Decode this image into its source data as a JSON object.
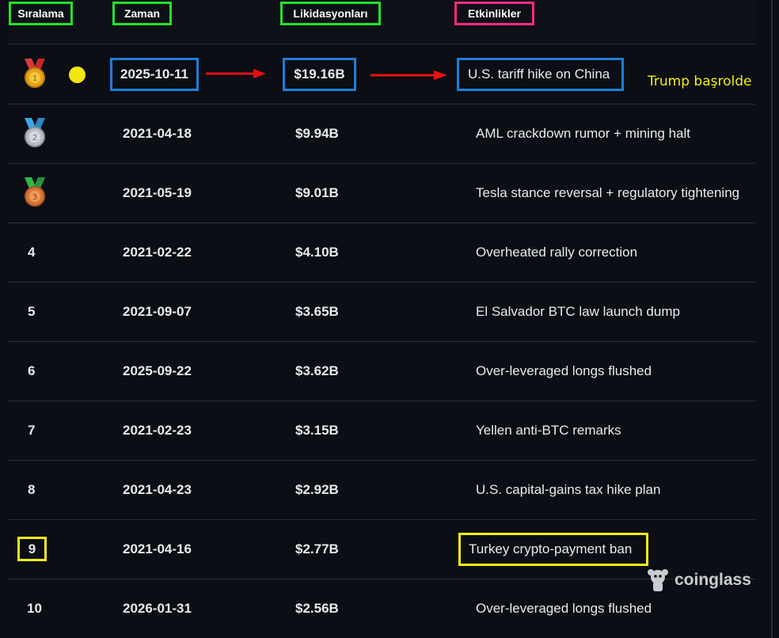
{
  "headers": {
    "rank": "Sıralama",
    "time": "Zaman",
    "liquidations": "Likidasyonları",
    "events": "Etkinlikler"
  },
  "rows": [
    {
      "rank": "",
      "medal": "gold-medal-icon",
      "date": "2025-10-11",
      "value": "$19.16B",
      "event": "U.S. tariff hike on China"
    },
    {
      "rank": "",
      "medal": "silver-medal-icon",
      "date": "2021-04-18",
      "value": "$9.94B",
      "event": "AML crackdown rumor + mining halt"
    },
    {
      "rank": "",
      "medal": "bronze-medal-icon",
      "date": "2021-05-19",
      "value": "$9.01B",
      "event": "Tesla stance reversal + regulatory tightening"
    },
    {
      "rank": "4",
      "date": "2021-02-22",
      "value": "$4.10B",
      "event": "Overheated rally correction"
    },
    {
      "rank": "5",
      "date": "2021-09-07",
      "value": "$3.65B",
      "event": "El Salvador BTC law launch dump"
    },
    {
      "rank": "6",
      "date": "2025-09-22",
      "value": "$3.62B",
      "event": "Over-leveraged longs flushed"
    },
    {
      "rank": "7",
      "date": "2021-02-23",
      "value": "$3.15B",
      "event": "Yellen anti-BTC remarks"
    },
    {
      "rank": "8",
      "date": "2021-04-23",
      "value": "$2.92B",
      "event": "U.S. capital-gains tax hike plan"
    },
    {
      "rank": "9",
      "date": "2021-04-16",
      "value": "$2.77B",
      "event": "Turkey crypto-payment ban"
    },
    {
      "rank": "10",
      "date": "2026-01-31",
      "value": "$2.56B",
      "event": "Over-leveraged longs flushed"
    }
  ],
  "annotation": {
    "note": "Trump başrolde",
    "highlight_color": "#f6ee12",
    "box_blue": "#1e7ed6",
    "box_green": "#22e12b",
    "box_pink": "#ff2a86",
    "arrow_color": "#e81010"
  },
  "brand": {
    "name": "coinglass",
    "icon": "coinglass-logo-icon"
  }
}
